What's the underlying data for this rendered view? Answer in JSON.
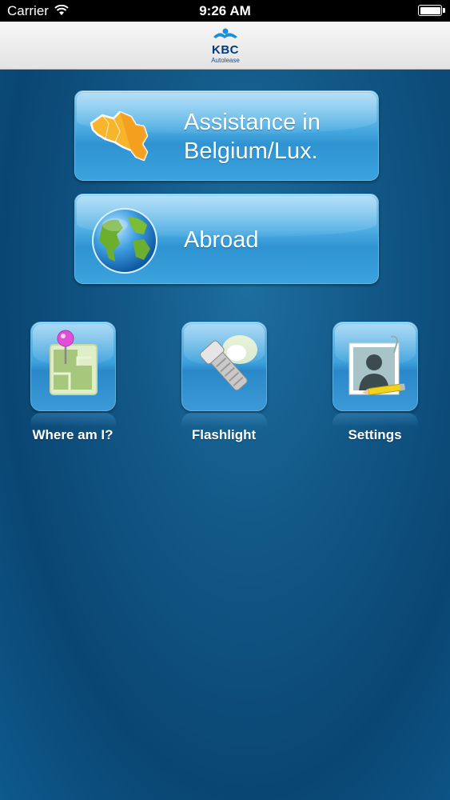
{
  "status_bar": {
    "carrier": "Carrier",
    "time": "9:26 AM"
  },
  "header": {
    "logo_text": "KBC",
    "logo_subtitle": "Autolease"
  },
  "main_buttons": {
    "belgium": {
      "line1": "Assistance in",
      "line2": "Belgium/Lux.",
      "icon": "belgium-map-icon"
    },
    "abroad": {
      "label": "Abroad",
      "icon": "globe-icon"
    }
  },
  "shortcuts": {
    "where": {
      "label": "Where am I?",
      "icon": "map-pin-icon"
    },
    "flashlight": {
      "label": "Flashlight",
      "icon": "flashlight-icon"
    },
    "settings": {
      "label": "Settings",
      "icon": "profile-settings-icon"
    }
  },
  "colors": {
    "background": "#0d5a8c",
    "button": "#3ba3dd",
    "header": "#ececec",
    "brand": "#003c7d"
  }
}
